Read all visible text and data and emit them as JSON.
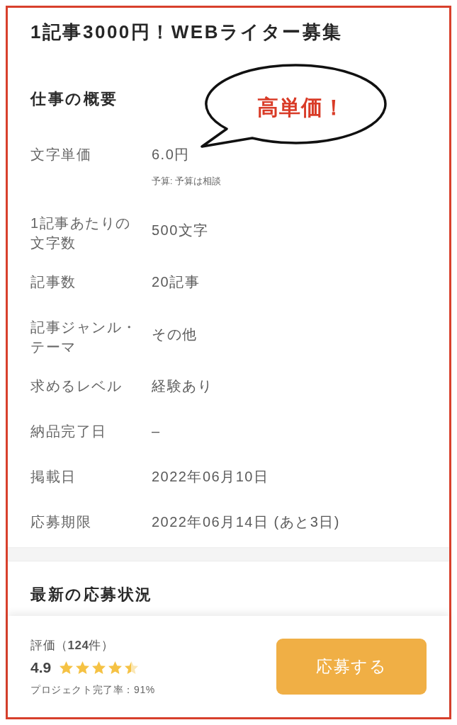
{
  "title": "1記事3000円！WEBライター募集",
  "overview": {
    "heading": "仕事の概要",
    "callout": "高単価！",
    "rows": [
      {
        "label": "文字単価",
        "value": "6.0円",
        "note": "予算: 予算は相談"
      },
      {
        "label": "1記事あたりの文字数",
        "value": "500文字"
      },
      {
        "label": "記事数",
        "value": "20記事"
      },
      {
        "label": "記事ジャンル・テーマ",
        "value": "その他"
      },
      {
        "label": "求めるレベル",
        "value": "経験あり"
      },
      {
        "label": "納品完了日",
        "value": "–"
      },
      {
        "label": "掲載日",
        "value": "2022年06月10日"
      },
      {
        "label": "応募期限",
        "value": "2022年06月14日 (あと3日)"
      }
    ]
  },
  "applications": {
    "heading": "最新の応募状況"
  },
  "footer": {
    "rating_label": "評価（**124**件）",
    "score": "4.9",
    "stars": 4.5,
    "completion": "プロジェクト完了率：91%",
    "apply_button": "応募する"
  }
}
